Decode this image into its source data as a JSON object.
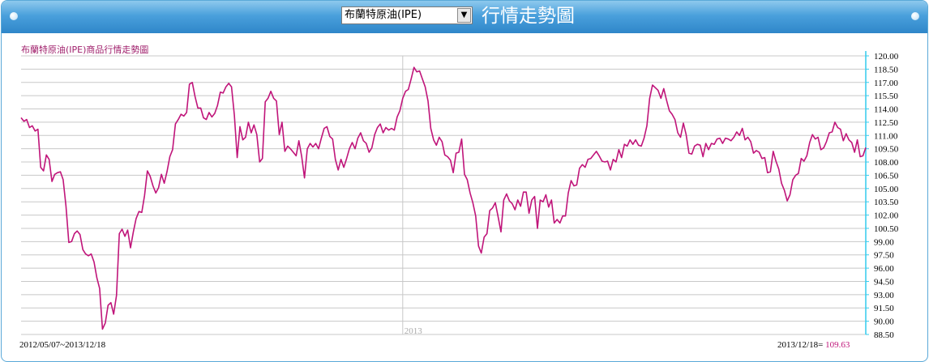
{
  "header": {
    "select_value": "布蘭特原油(IPE)",
    "title": "行情走勢圖"
  },
  "colors": {
    "header_top": "#8ec9ee",
    "header_bottom": "#2f86c9",
    "line": "#c0157a",
    "axis": "#33ccee",
    "grid": "#c8c8c8"
  },
  "chart_data": {
    "type": "line",
    "title": "布蘭特原油(IPE)商品行情走勢圖",
    "ylim": [
      88.5,
      120.0
    ],
    "ytick_labels": [
      "120.00",
      "118.50",
      "117.00",
      "115.50",
      "114.00",
      "112.50",
      "111.00",
      "109.50",
      "108.00",
      "106.50",
      "105.00",
      "103.50",
      "102.00",
      "100.50",
      "99.00",
      "97.50",
      "96.00",
      "94.50",
      "93.00",
      "91.50",
      "90.00",
      "88.50"
    ],
    "year_marker": "2013",
    "grid": true,
    "date_range": "2012/05/07~2013/12/18",
    "last_label": "2013/12/18=",
    "last_value": "109.63",
    "series": [
      {
        "values": [
          113.0,
          112.6,
          112.8,
          111.9,
          112.1,
          111.5,
          111.7,
          107.4,
          107.0,
          108.8,
          108.3,
          105.8,
          106.6,
          106.8,
          106.9,
          106.0,
          103.0,
          98.9,
          99.0,
          99.9,
          100.2,
          99.8,
          98.1,
          97.6,
          97.4,
          97.6,
          96.7,
          94.9,
          93.7,
          89.1,
          89.8,
          91.8,
          92.1,
          90.8,
          92.9,
          99.9,
          100.4,
          99.6,
          100.3,
          98.3,
          100.1,
          101.6,
          102.4,
          102.3,
          104.2,
          107.0,
          106.4,
          105.3,
          104.5,
          105.1,
          106.6,
          105.6,
          106.9,
          108.6,
          109.4,
          112.3,
          112.8,
          113.4,
          113.2,
          113.6,
          116.8,
          117.0,
          115.4,
          114.1,
          114.1,
          113.0,
          112.8,
          113.6,
          113.1,
          113.5,
          114.4,
          115.9,
          115.8,
          116.5,
          116.9,
          116.5,
          113.3,
          108.5,
          112.0,
          110.5,
          110.8,
          112.5,
          111.3,
          112.2,
          111.1,
          108.0,
          108.4,
          114.8,
          115.2,
          116.0,
          115.2,
          114.9,
          111.1,
          112.5,
          109.2,
          109.8,
          109.5,
          109.1,
          108.7,
          110.4,
          108.6,
          106.2,
          109.5,
          110.1,
          109.7,
          110.1,
          109.5,
          110.7,
          111.8,
          112.0,
          110.9,
          110.6,
          108.3,
          107.1,
          108.3,
          107.4,
          108.4,
          109.5,
          110.2,
          109.5,
          110.7,
          111.3,
          110.4,
          110.1,
          109.1,
          109.6,
          111.1,
          111.9,
          112.3,
          111.3,
          111.9,
          111.6,
          111.8,
          111.6,
          113.1,
          113.8,
          115.2,
          116.0,
          116.2,
          117.4,
          118.7,
          118.2,
          118.3,
          117.4,
          116.5,
          114.9,
          111.8,
          110.5,
          109.9,
          110.8,
          110.3,
          108.8,
          108.6,
          108.2,
          106.8,
          109.0,
          109.1,
          110.6,
          106.6,
          106.0,
          104.5,
          103.4,
          101.9,
          98.5,
          97.7,
          99.5,
          99.9,
          102.5,
          102.8,
          103.4,
          101.8,
          100.1,
          103.7,
          104.4,
          103.6,
          103.3,
          102.6,
          103.7,
          103.0,
          104.6,
          104.6,
          102.2,
          103.7,
          104.1,
          100.5,
          103.7,
          103.5,
          104.3,
          102.9,
          103.7,
          101.1,
          101.5,
          101.1,
          101.9,
          101.9,
          104.5,
          105.9,
          105.3,
          105.4,
          107.3,
          107.7,
          107.4,
          108.3,
          108.4,
          108.8,
          109.2,
          108.7,
          108.1,
          108.0,
          108.1,
          107.1,
          108.3,
          108.0,
          109.4,
          108.5,
          110.0,
          109.8,
          110.5,
          110.0,
          110.5,
          109.9,
          109.8,
          110.7,
          112.1,
          115.2,
          116.7,
          116.4,
          116.1,
          115.2,
          116.3,
          115.0,
          113.8,
          113.4,
          112.8,
          111.3,
          110.8,
          112.4,
          111.1,
          109.0,
          108.9,
          109.8,
          110.0,
          109.9,
          108.6,
          110.1,
          109.4,
          110.1,
          110.0,
          110.6,
          110.7,
          110.1,
          110.7,
          110.6,
          110.4,
          110.8,
          111.4,
          111.0,
          111.8,
          110.5,
          110.8,
          110.3,
          109.0,
          109.3,
          109.1,
          108.4,
          108.5,
          106.8,
          106.9,
          109.2,
          108.1,
          107.2,
          105.6,
          104.8,
          103.6,
          104.3,
          106.0,
          106.5,
          106.7,
          108.4,
          108.1,
          108.7,
          110.2,
          111.1,
          110.6,
          110.8,
          109.4,
          109.6,
          110.3,
          111.3,
          111.4,
          112.5,
          111.9,
          111.7,
          110.4,
          111.2,
          110.5,
          110.2,
          109.1,
          110.5,
          108.6,
          108.7,
          109.63
        ]
      }
    ]
  }
}
